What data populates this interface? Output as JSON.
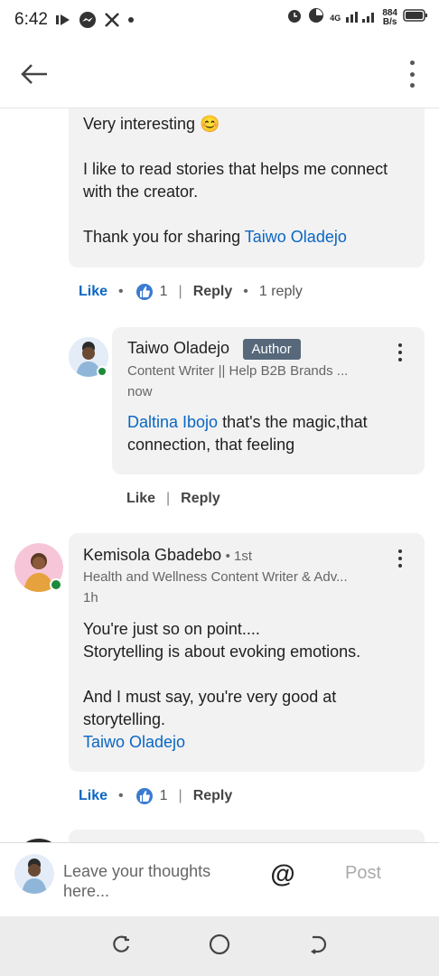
{
  "status_bar": {
    "time": "6:42",
    "net_speed_top": "884",
    "net_speed_bottom": "B/s",
    "network": "4G"
  },
  "comment1": {
    "lines": [
      "Very interesting 😊",
      "I like to read stories that helps me connect",
      "with the creator.",
      "Thank you for sharing"
    ],
    "mention": "Taiwo Oladejo",
    "like_label": "Like",
    "reaction_count": "1",
    "reply_label": "Reply",
    "replies_label": "1 reply"
  },
  "reply1": {
    "name": "Taiwo Oladejo",
    "badge": "Author",
    "headline": "Content Writer || Help B2B Brands ...",
    "time": "now",
    "mention": "Daltina Ibojo",
    "text_after_mention": " that's the magic,that",
    "text_line2": "connection, that feeling",
    "like_label": "Like",
    "reply_label": "Reply"
  },
  "comment2": {
    "name": "Kemisola Gbadebo",
    "degree": "• 1st",
    "headline": "Health and Wellness Content Writer & Adv...",
    "time": "1h",
    "lines": [
      "You're just so on point....",
      "Storytelling is about evoking emotions.",
      "And I must say, you're very good at",
      "storytelling."
    ],
    "mention": "Taiwo Oladejo",
    "like_label": "Like",
    "reaction_count": "1",
    "reply_label": "Reply"
  },
  "composer": {
    "placeholder_line1": "Leave your thoughts",
    "placeholder_line2": "here...",
    "at_label": "@",
    "post_label": "Post"
  },
  "colors": {
    "link": "#0a66c2",
    "bubble": "#f2f2f2",
    "badge": "#56687a",
    "online": "#1b8a3a"
  }
}
